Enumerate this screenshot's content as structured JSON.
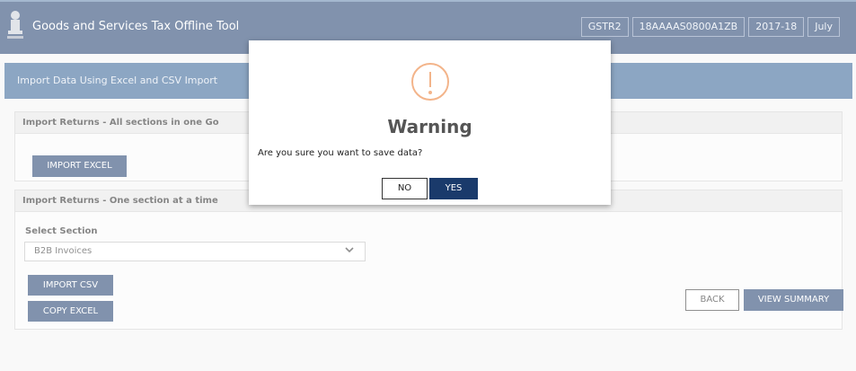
{
  "header": {
    "app_title": "Goods and Services Tax Offline Tool",
    "return_type": "GSTR2",
    "gstin": "18AAAAS0800A1ZB",
    "financial_year": "2017-18",
    "month": "July"
  },
  "page": {
    "title": "Import Data Using Excel and CSV Import"
  },
  "panel_all": {
    "heading": "Import Returns - All sections in one Go",
    "import_excel_label": "IMPORT EXCEL"
  },
  "panel_one": {
    "heading": "Import Returns - One section at a time",
    "select_label": "Select Section",
    "selected_value": "B2B Invoices",
    "import_csv_label": "IMPORT CSV",
    "copy_excel_label": "COPY EXCEL"
  },
  "footer": {
    "back_label": "BACK",
    "view_summary_label": "VIEW SUMMARY"
  },
  "modal": {
    "icon": "warning-icon",
    "title": "Warning",
    "message": "Are you sure you want to save data?",
    "no_label": "NO",
    "yes_label": "YES"
  },
  "colors": {
    "header_bg": "#1a3a6b",
    "page_header_bg": "#2e5d92",
    "button_bg": "#1a3a6b",
    "warning_icon": "#f3b48a"
  }
}
